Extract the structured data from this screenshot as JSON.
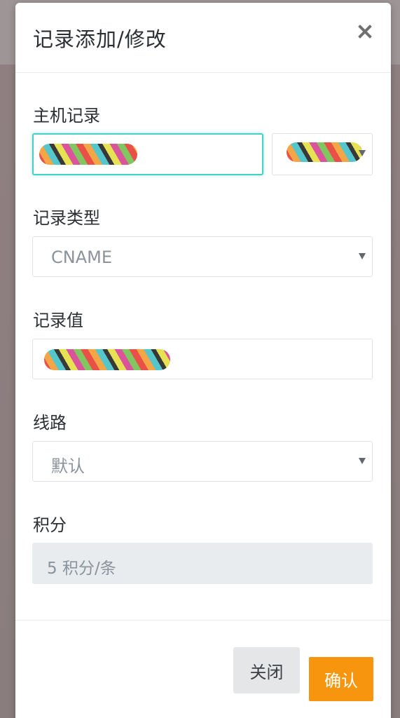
{
  "modal": {
    "title": "记录添加/修改",
    "close_icon": "close-icon"
  },
  "fields": {
    "host_record": {
      "label": "主机记录",
      "value": "",
      "domain_value": ""
    },
    "record_type": {
      "label": "记录类型",
      "value": "CNAME"
    },
    "record_value": {
      "label": "记录值",
      "value": ""
    },
    "line": {
      "label": "线路",
      "value": "默认"
    },
    "points": {
      "label": "积分",
      "value": "5 积分/条"
    }
  },
  "footer": {
    "close_label": "关闭",
    "confirm_label": "确认"
  },
  "colors": {
    "accent_focus": "#48cfc6",
    "confirm": "#f7950e"
  }
}
